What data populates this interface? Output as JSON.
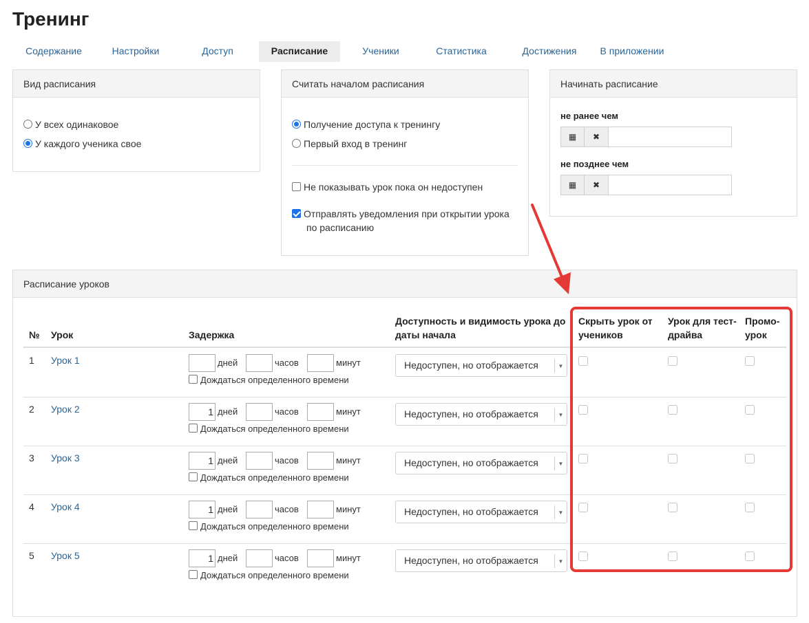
{
  "page": {
    "title": "Тренинг"
  },
  "tabs": [
    {
      "label": "Содержание",
      "active": false
    },
    {
      "label": "Настройки",
      "active": false
    },
    {
      "label": "Доступ",
      "active": false
    },
    {
      "label": "Расписание",
      "active": true
    },
    {
      "label": "Ученики",
      "active": false
    },
    {
      "label": "Статистика",
      "active": false
    },
    {
      "label": "Достижения",
      "active": false
    },
    {
      "label": "В приложении",
      "active": false
    }
  ],
  "schedule_type": {
    "title": "Вид расписания",
    "options": [
      {
        "label": "У всех одинаковое",
        "selected": false
      },
      {
        "label": "У каждого ученика свое",
        "selected": true
      }
    ]
  },
  "schedule_start": {
    "title": "Считать началом расписания",
    "options": [
      {
        "label": "Получение доступа к тренингу",
        "selected": true
      },
      {
        "label": "Первый вход в тренинг",
        "selected": false
      }
    ],
    "hide_unavailable": {
      "label": "Не показывать урок пока он недоступен",
      "checked": false
    },
    "notify": {
      "label_line1": "Отправлять уведомления при открытии урока",
      "label_line2": "по расписанию",
      "checked": true
    }
  },
  "begin_schedule": {
    "title": "Начинать расписание",
    "not_earlier": {
      "label": "не ранее чем",
      "value": ""
    },
    "not_later": {
      "label": "не позднее чем",
      "value": ""
    },
    "icons": {
      "calendar": "calendar-icon",
      "clear": "close-icon"
    }
  },
  "lessons_schedule": {
    "title": "Расписание уроков",
    "columns": {
      "num": "№",
      "lesson": "Урок",
      "delay": "Задержка",
      "availability_line1": "Доступность и видимость урока до",
      "availability_line2": "даты начала",
      "hide_line1": "Скрыть урок от",
      "hide_line2": "учеников",
      "test_line1": "Урок для тест-",
      "test_line2": "драйва",
      "promo_line1": "Промо-",
      "promo_line2": "урок"
    },
    "units": {
      "days": "дней",
      "hours": "часов",
      "minutes": "минут"
    },
    "wait_label": "Дождаться определенного времени",
    "rows": [
      {
        "num": "1",
        "lesson": "Урок 1",
        "days": "",
        "hours": "",
        "minutes": "",
        "availability": "Недоступен, но отображается"
      },
      {
        "num": "2",
        "lesson": "Урок 2",
        "days": "1",
        "hours": "",
        "minutes": "",
        "availability": "Недоступен, но отображается"
      },
      {
        "num": "3",
        "lesson": "Урок 3",
        "days": "1",
        "hours": "",
        "minutes": "",
        "availability": "Недоступен, но отображается"
      },
      {
        "num": "4",
        "lesson": "Урок 4",
        "days": "1",
        "hours": "",
        "minutes": "",
        "availability": "Недоступен, но отображается"
      },
      {
        "num": "5",
        "lesson": "Урок 5",
        "days": "1",
        "hours": "",
        "minutes": "",
        "availability": "Недоступен, но отображается"
      }
    ]
  },
  "annotation": {
    "color": "#e53935"
  }
}
